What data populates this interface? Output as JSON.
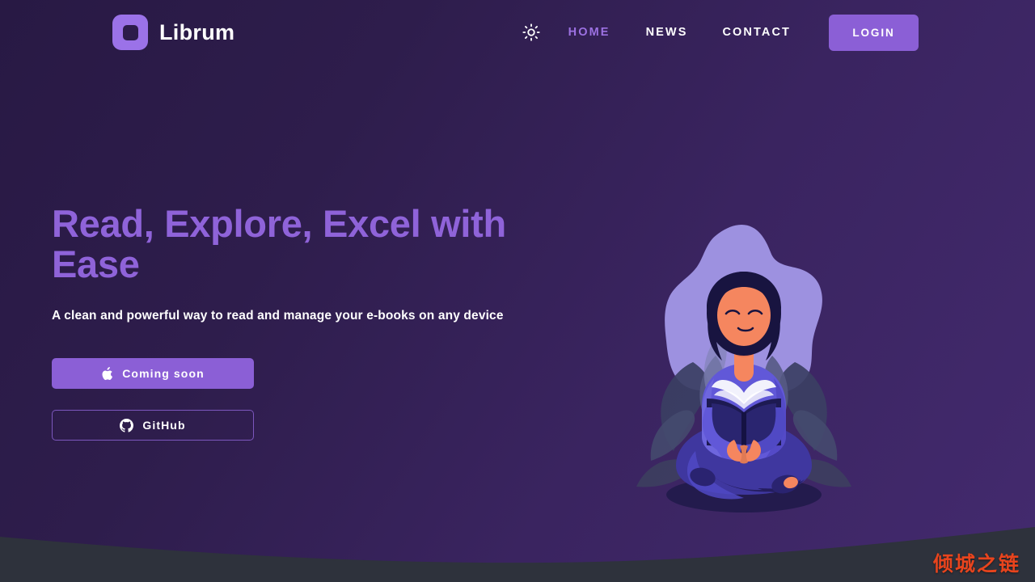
{
  "brand": {
    "name": "Librum",
    "logo_icon": "square-outline-logo-icon",
    "logo_color": "#9b72e8"
  },
  "header": {
    "theme_toggle_icon": "sun-icon",
    "nav": [
      {
        "label": "HOME",
        "active": true
      },
      {
        "label": "NEWS",
        "active": false
      },
      {
        "label": "CONTACT",
        "active": false
      }
    ],
    "login_label": "LOGIN",
    "login_color": "#8b5fd6"
  },
  "hero": {
    "title": "Read, Explore, Excel with Ease",
    "title_color": "#8f63d9",
    "subtitle": "A clean and powerful way to read and manage your e-books on any device",
    "buttons": [
      {
        "label": "Coming soon",
        "icon": "apple-icon",
        "style": "primary"
      },
      {
        "label": "GitHub",
        "icon": "github-icon",
        "style": "outline"
      }
    ]
  },
  "illustration": {
    "name": "woman-reading-book-illustration",
    "blob_color": "#9d91e0",
    "skin_color": "#f5865f",
    "hair_color": "#181440",
    "shirt_color": "#6158d8",
    "pants_color": "#4a42b0"
  },
  "watermark": {
    "text": "倾城之链",
    "color": "#e8441d"
  },
  "bottom_wave": {
    "color": "#2e323c"
  }
}
